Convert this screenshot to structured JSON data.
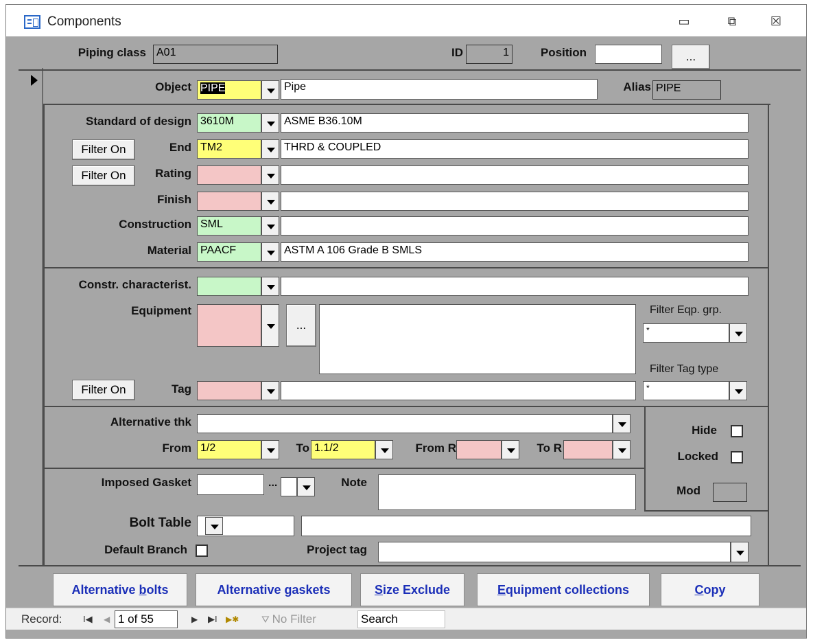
{
  "window": {
    "title": "Components",
    "minimize": "▭",
    "restore": "⧉",
    "close": "☒"
  },
  "header": {
    "piping_class_label": "Piping class",
    "piping_class_value": "A01",
    "id_label": "ID",
    "id_value": "1",
    "position_label": "Position",
    "position_value": "",
    "ellipsis": "..."
  },
  "object": {
    "label": "Object",
    "code": "PIPE",
    "desc": "Pipe",
    "alias_label": "Alias",
    "alias_value": "PIPE"
  },
  "fields": {
    "standard_label": "Standard of design",
    "standard_code": "3610M",
    "standard_desc": "ASME B36.10M",
    "end_label": "End",
    "end_code": "TM2",
    "end_desc": "THRD & COUPLED",
    "rating_label": "Rating",
    "rating_code": "",
    "rating_desc": "",
    "finish_label": "Finish",
    "finish_code": "",
    "finish_desc": "",
    "construction_label": "Construction",
    "construction_code": "SML",
    "construction_desc": "",
    "material_label": "Material",
    "material_code": "PAACF",
    "material_desc": "ASTM A 106 Grade B SMLS",
    "filter_on": "Filter On"
  },
  "equip": {
    "constr_label": "Constr. characterist.",
    "constr_value": "",
    "constr_desc": "",
    "equipment_label": "Equipment",
    "equipment_ellipsis": "...",
    "filter_eqp_label": "Filter Eqp. grp.",
    "filter_eqp_value": "*",
    "filter_tag_label": "Filter Tag type",
    "filter_tag_value": "*",
    "tag_label": "Tag",
    "filter_on": "Filter On"
  },
  "alt": {
    "alt_thk_label": "Alternative thk",
    "from_label": "From",
    "from_value": "1/2",
    "to_label": "To",
    "to_value": "1.1/2",
    "from_r_label": "From R",
    "to_r_label": "To R",
    "hide_label": "Hide",
    "locked_label": "Locked",
    "mod_label": "Mod"
  },
  "gasket": {
    "imposed_label": "Imposed Gasket",
    "ellipsis": "...",
    "note_label": "Note",
    "bolt_label": "Bolt Table",
    "default_branch_label": "Default Branch",
    "project_tag_label": "Project tag"
  },
  "buttons": {
    "alt_bolts_pre": "Alternative ",
    "alt_bolts_u": "b",
    "alt_bolts_post": "olts",
    "alt_gaskets_pre": "Alternative ",
    "alt_gaskets_u": "g",
    "alt_gaskets_post": "askets",
    "size_u": "S",
    "size_post": "ize Exclude",
    "equip_u": "E",
    "equip_post": "quipment collections",
    "copy_u": "C",
    "copy_post": "opy"
  },
  "status": {
    "record_label": "Record:",
    "first": "I◀",
    "prev": "◀",
    "record_value": "1 of 55",
    "next": "▶",
    "last": "▶I",
    "new": "▶✱",
    "no_filter": "No Filter",
    "search": "Search"
  }
}
